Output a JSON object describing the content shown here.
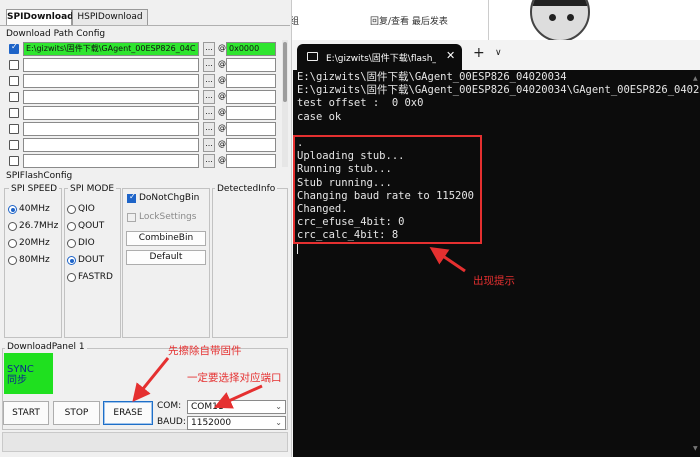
{
  "background_page": {
    "col1_text": "组",
    "col2_text": "回复/查看  最后发表"
  },
  "tool": {
    "tabs": [
      {
        "label": "SPIDownload",
        "active": true
      },
      {
        "label": "HSPIDownload",
        "active": false
      }
    ],
    "download_path_config_label": "Download Path Config",
    "path_rows": [
      {
        "checked": true,
        "path": "E:\\gizwits\\固件下载\\GAgent_00ESP826_04C",
        "offset": "0x0000",
        "highlight": true
      },
      {
        "checked": false,
        "path": "",
        "offset": "",
        "highlight": false
      },
      {
        "checked": false,
        "path": "",
        "offset": "",
        "highlight": false
      },
      {
        "checked": false,
        "path": "",
        "offset": "",
        "highlight": false
      },
      {
        "checked": false,
        "path": "",
        "offset": "",
        "highlight": false
      },
      {
        "checked": false,
        "path": "",
        "offset": "",
        "highlight": false
      },
      {
        "checked": false,
        "path": "",
        "offset": "",
        "highlight": false
      },
      {
        "checked": false,
        "path": "",
        "offset": "",
        "highlight": false
      }
    ],
    "browse_label": "...",
    "at_label": "@",
    "spi_flash_config_label": "SPIFlashConfig",
    "spi_speed": {
      "title": "SPI SPEED",
      "options": [
        "40MHz",
        "26.7MHz",
        "20MHz",
        "80MHz"
      ],
      "selected": "40MHz"
    },
    "spi_mode": {
      "title": "SPI MODE",
      "options": [
        "QIO",
        "QOUT",
        "DIO",
        "DOUT",
        "FASTRD"
      ],
      "selected": "DOUT"
    },
    "do_not_chg_bin": {
      "label": "DoNotChgBin",
      "checked": true
    },
    "lock_settings": {
      "label": "LockSettings",
      "checked": false
    },
    "combine_bin_label": "CombineBin",
    "default_label": "Default",
    "detected_info_label": "DetectedInfo",
    "download_panel_label": "DownloadPanel 1",
    "sync_text_line1": "SYNC",
    "sync_text_line2": "同步",
    "start_label": "START",
    "stop_label": "STOP",
    "erase_label": "ERASE",
    "com_label": "COM:",
    "com_value": "COM11",
    "baud_label": "BAUD:",
    "baud_value": "1152000"
  },
  "terminal": {
    "tab_title": "E:\\gizwits\\固件下载\\flash_dow",
    "lines": [
      "E:\\gizwits\\固件下载\\GAgent_00ESP826_04020034",
      "E:\\gizwits\\固件下载\\GAgent_00ESP826_04020034\\GAgent_00ESP826_0402",
      "test offset :  0 0x0",
      "case ok",
      "",
      ".",
      "Uploading stub...",
      "Running stub...",
      "Stub running...",
      "Changing baud rate to 115200",
      "Changed.",
      "crc_efuse_4bit: 0",
      "crc_calc_4bit: 8"
    ]
  },
  "annotations": {
    "erase_note": "先擦除自带固件",
    "port_note": "一定要选择对应端口",
    "output_note": "出现提示"
  },
  "colors": {
    "annotation_red": "#e53030",
    "highlight_green": "#2fe52f",
    "terminal_bg": "#0c0c0c"
  }
}
